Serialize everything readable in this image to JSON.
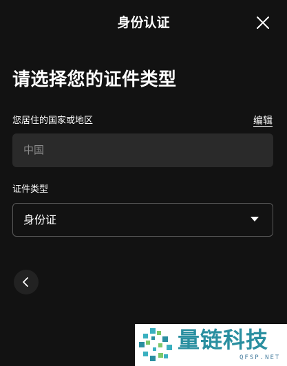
{
  "header": {
    "title": "身份认证"
  },
  "main": {
    "title": "请选择您的证件类型",
    "country_label": "您居住的国家或地区",
    "edit_label": "编辑",
    "country_value": "中国",
    "doc_type_label": "证件类型",
    "doc_type_value": "身份证"
  },
  "icons": {
    "close": "close-icon",
    "dropdown": "caret-down-icon",
    "back": "chevron-left-icon"
  },
  "colors": {
    "background": "#121212",
    "field_fill": "#2a2a2a",
    "field_border": "#5a5a5a",
    "muted_text": "#8a8a8a",
    "watermark_accent": "#2a8fa0"
  },
  "watermark": {
    "text": "量链科技",
    "sub": "QFSP.NET"
  }
}
